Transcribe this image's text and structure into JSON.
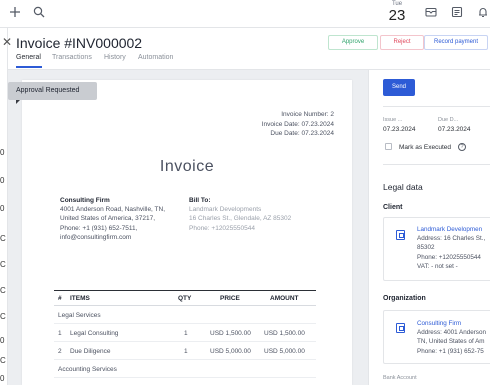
{
  "topbar": {
    "icons": [
      "plus-icon",
      "search-icon",
      "mail-icon",
      "notes-icon",
      "bell-icon"
    ],
    "date": {
      "dow": "Tue",
      "day": "23"
    }
  },
  "left_strip": {
    "chars": [
      "0",
      "0",
      "0",
      "C",
      "C",
      "C",
      "C",
      "0",
      "C",
      "0",
      "C"
    ]
  },
  "header": {
    "title": "Invoice #INV000002",
    "buttons": {
      "approve": "Approve",
      "reject": "Reject",
      "record": "Record payment"
    },
    "tabs": [
      "General",
      "Transactions",
      "History",
      "Automation"
    ]
  },
  "document": {
    "badge": "Approval Requested",
    "meta": {
      "number": "Invoice Number: 2",
      "date": "Invoice Date: 07.23.2024",
      "due": "Due Date: 07.23.2024"
    },
    "heading": "Invoice",
    "from": {
      "name": "Consulting Firm",
      "address": "4001 Anderson Road, Nashville, TN, United States of America, 37217,",
      "phone": "Phone: +1 (931) 652-7511,",
      "email": "info@consultingfirm.com"
    },
    "bill_to": {
      "label": "Bill To:",
      "name": "Landmark Developments",
      "address": "16 Charles St., Glendale, AZ 85302",
      "phone": "Phone: +12025550544"
    },
    "table": {
      "headers": [
        "#",
        "ITEMS",
        "QTY",
        "PRICE",
        "AMOUNT"
      ],
      "section_1": "Legal Services",
      "rows": [
        {
          "num": "1",
          "item": "Legal Consulting",
          "qty": "1",
          "price": "USD 1,500.00",
          "amount": "USD 1,500.00"
        },
        {
          "num": "2",
          "item": "Due Diligence",
          "qty": "1",
          "price": "USD 5,000.00",
          "amount": "USD 5,000.00"
        }
      ],
      "section_2": "Accounting Services"
    }
  },
  "panel": {
    "send": "Send",
    "issue_label": "Issue ...",
    "issue_value": "07.23.2024",
    "due_label": "Due D...",
    "due_value": "07.23.2024",
    "executed_label": "Mark as Executed",
    "legal_title": "Legal data",
    "client_title": "Client",
    "client": {
      "name": "Landmark Developmen",
      "line1": "Address: 16 Charles St.,",
      "line2": "85302",
      "line3": "Phone: +12025550544",
      "line4": "VAT: - not set -"
    },
    "org_title": "Organization",
    "org": {
      "name": "Consulting Firm",
      "line1": "Address: 4001 Anderson",
      "line2": "TN, United States of Am",
      "line3": "Phone: +1 (931) 652-75"
    },
    "bank_label": "Bank Account"
  },
  "colors": {
    "accent": "#2d5bd6",
    "approve": "#2fa36b",
    "reject": "#e0475b"
  }
}
